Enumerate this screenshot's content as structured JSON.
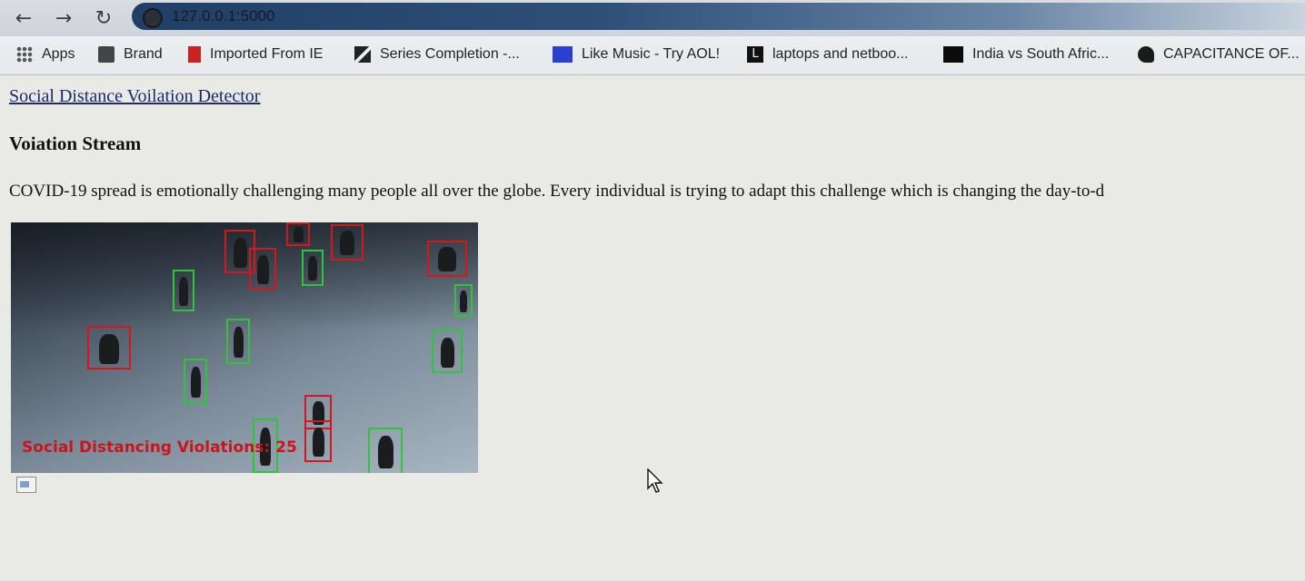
{
  "browser": {
    "url": "127.0.0.1:5000",
    "bookmarks": [
      {
        "label": "Apps",
        "icon": "apps-grid-icon"
      },
      {
        "label": "Brand",
        "icon": "brand-icon"
      },
      {
        "label": "Imported From IE",
        "icon": "folder-red-icon"
      },
      {
        "label": "Series Completion -...",
        "icon": "series-icon"
      },
      {
        "label": "Like Music - Try AOL!",
        "icon": "aol-icon"
      },
      {
        "label": "laptops and netboo...",
        "icon": "l-letter-icon"
      },
      {
        "label": "India vs South Afric...",
        "icon": "black-square-icon"
      },
      {
        "label": "CAPACITANCE OF...",
        "icon": "leaf-icon"
      }
    ]
  },
  "page": {
    "brand_link": "Social Distance Voilation Detector",
    "heading": "Voiation Stream",
    "paragraph": "COVID-19 spread is emotionally challenging many people all over the globe. Every individual is trying to adapt this challenge which is changing the day-to-d",
    "stream_overlay": "Social Distancing Violations: 25"
  },
  "colors": {
    "link": "#1a2a6c",
    "safe_box": "#2fc43a",
    "violation_box": "#d6161a",
    "overlay_text": "#c8161b"
  }
}
